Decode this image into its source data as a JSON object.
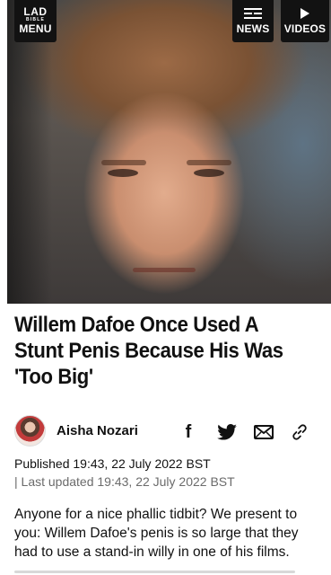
{
  "nav": {
    "logo_top": "LAD",
    "logo_bottom": "BIBLE",
    "menu_label": "MENU",
    "news_label": "NEWS",
    "videos_label": "VIDEOS"
  },
  "hero": {
    "icon": "portrait-photo"
  },
  "article": {
    "headline": "Willem Dafoe Once Used A Stunt Penis Because His Was 'Too Big'",
    "author": "Aisha Nozari",
    "published": "Published 19:43, 22 July 2022 BST",
    "updated": "| Last updated 19:43, 22 July 2022 BST",
    "body": "Anyone for a nice phallic tidbit? We present to you: Willem Dafoe's penis is so large that they had to use a stand-in willy in one of his films."
  },
  "share": {
    "facebook_glyph": "f",
    "icons": [
      "facebook-icon",
      "twitter-icon",
      "mail-icon",
      "link-icon"
    ]
  },
  "colors": {
    "nav_bg": "#121212",
    "text": "#111111",
    "muted": "#6b6b6b"
  }
}
